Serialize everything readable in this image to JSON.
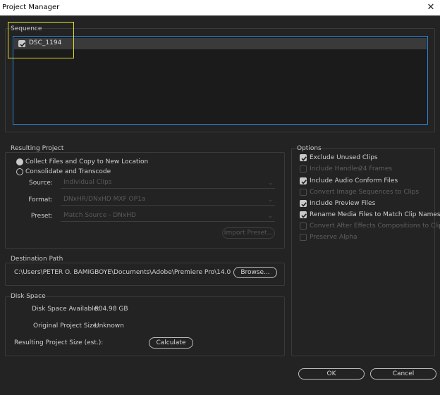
{
  "window": {
    "title": "Project Manager",
    "close_glyph": "✕"
  },
  "sequence": {
    "label": "Sequence",
    "items": [
      {
        "name": "DSC_1194",
        "checked": true
      }
    ]
  },
  "resulting_project": {
    "label": "Resulting Project",
    "options": [
      {
        "label": "Collect Files and Copy to New Location",
        "selected": true
      },
      {
        "label": "Consolidate and Transcode",
        "selected": false
      }
    ],
    "source_label": "Source:",
    "source_value": "Individual Clips",
    "format_label": "Format:",
    "format_value": "DNxHR/DNxHD MXF OP1a",
    "preset_label": "Preset:",
    "preset_value": "Match Source - DNxHD",
    "import_preset_label": "Import Preset..."
  },
  "destination": {
    "label": "Destination Path",
    "path": "C:\\Users\\PETER O. BAMIGBOYE\\Documents\\Adobe\\Premiere Pro\\14.0",
    "browse_label": "Browse..."
  },
  "disk_space": {
    "label": "Disk Space",
    "available_label": "Disk Space Available:",
    "available_value": "804.98 GB",
    "original_label": "Original Project Size:",
    "original_value": "Unknown",
    "resulting_label": "Resulting Project Size (est.):",
    "calculate_label": "Calculate"
  },
  "options": {
    "label": "Options",
    "items": [
      {
        "label": "Exclude Unused Clips",
        "checked": true,
        "enabled": true
      },
      {
        "label": "Include Handles:",
        "checked": false,
        "enabled": false,
        "value": "24 Frames"
      },
      {
        "label": "Include Audio Conform Files",
        "checked": true,
        "enabled": true
      },
      {
        "label": "Convert Image Sequences to Clips",
        "checked": false,
        "enabled": false
      },
      {
        "label": "Include Preview Files",
        "checked": true,
        "enabled": true
      },
      {
        "label": "Rename Media Files to Match Clip Names",
        "checked": true,
        "enabled": true
      },
      {
        "label": "Convert After Effects Compositions to Clips",
        "checked": false,
        "enabled": false
      },
      {
        "label": "Preserve Alpha",
        "checked": false,
        "enabled": false
      }
    ]
  },
  "footer": {
    "ok_label": "OK",
    "cancel_label": "Cancel"
  },
  "colors": {
    "accent_blue": "#2c82d8",
    "highlight_yellow": "#e2df2a",
    "background": "#232323"
  }
}
